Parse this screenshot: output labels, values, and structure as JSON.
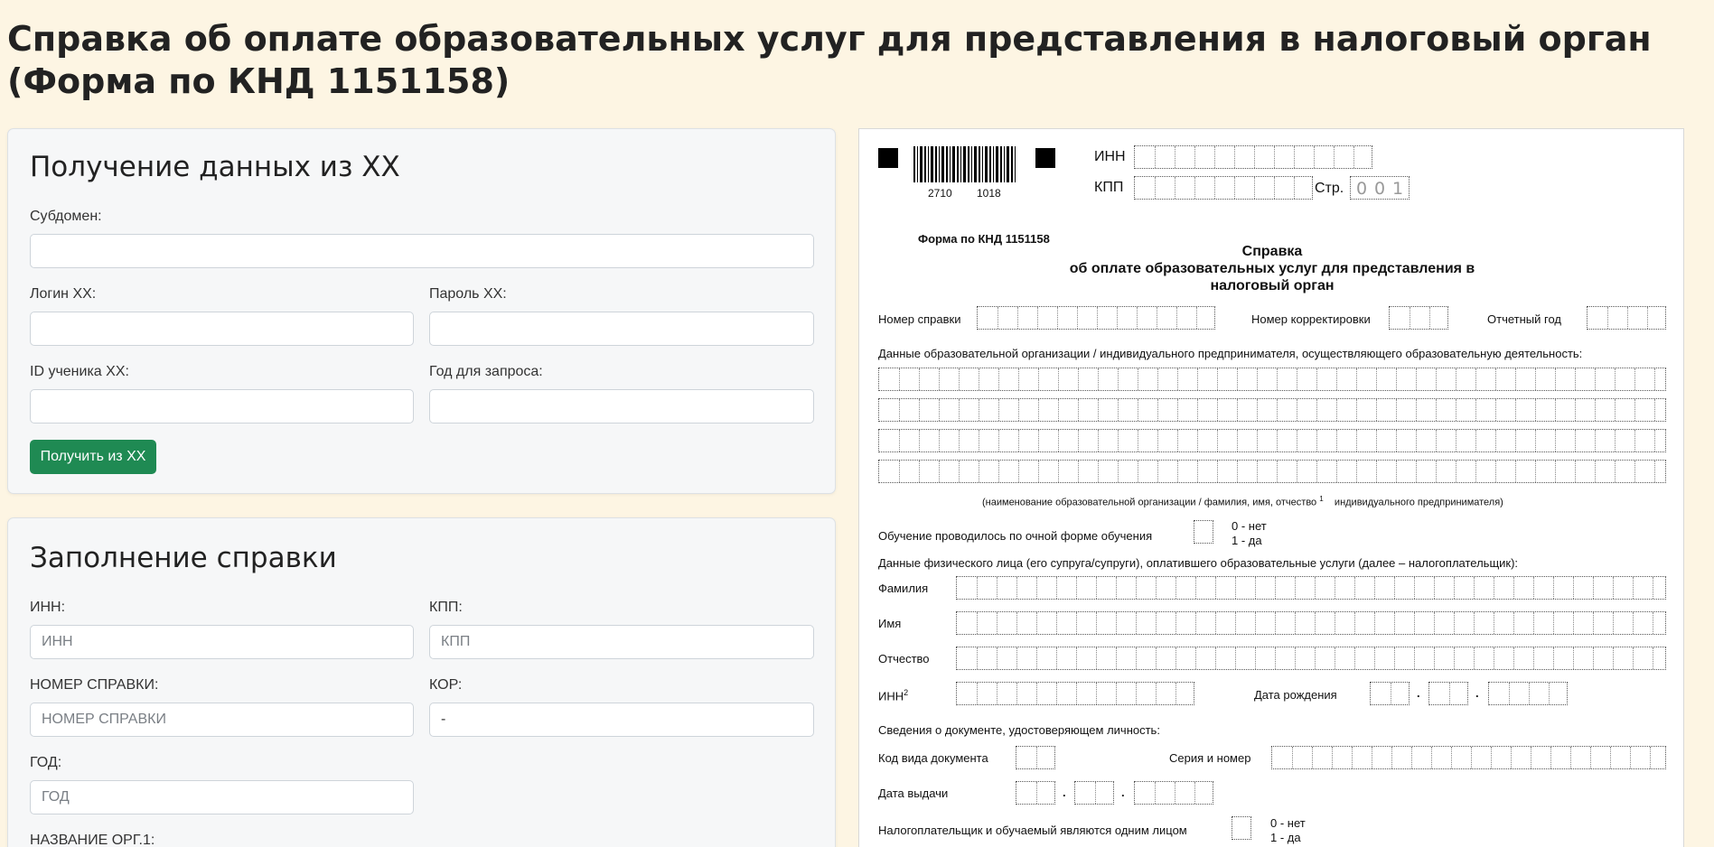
{
  "page": {
    "title": "Справка об оплате образовательных услуг для представления в налоговый орган (Форма по КНД 1151158)"
  },
  "fetch_card": {
    "title": "Получение данных из XX",
    "subdomain_label": "Субдомен:",
    "subdomain_value": "",
    "login_label": "Логин XX:",
    "login_value": "",
    "password_label": "Пароль XX:",
    "password_value": "",
    "student_id_label": "ID ученика XX:",
    "student_id_value": "",
    "year_label": "Год для запроса:",
    "year_value": "",
    "fetch_button": "Получить из XX"
  },
  "fill_card": {
    "title": "Заполнение справки",
    "inn_label": "ИНН:",
    "inn_placeholder": "ИНН",
    "kpp_label": "КПП:",
    "kpp_placeholder": "КПП",
    "number_label": "НОМЕР СПРАВКИ:",
    "number_placeholder": "НОМЕР СПРАВКИ",
    "kor_label": "КОР:",
    "kor_value": "-",
    "year_label": "ГОД:",
    "year_placeholder": "ГОД",
    "org_name_label": "НАЗВАНИЕ ОРГ.1:"
  },
  "form_preview": {
    "barcode_left": "2710",
    "barcode_right": "1018",
    "inn_label": "ИНН",
    "kpp_label": "КПП",
    "page_label": "Стр.",
    "page_number": [
      "0",
      "0",
      "1"
    ],
    "form_code": "Форма по КНД 1151158",
    "heading_line1": "Справка",
    "heading_line2": "об оплате образовательных услуг для представления в",
    "heading_line3": "налоговый орган",
    "cert_number_label": "Номер справки",
    "correction_label": "Номер корректировки",
    "report_year_label": "Отчетный год",
    "org_data_label": "Данные образовательной организации / индивидуального предпринимателя, осуществляющего образовательную деятельность:",
    "org_caption": "(наименование образовательной организации / фамилия, имя, отчество",
    "org_caption_sup": "1",
    "org_caption_tail": "индивидуального предпринимателя)",
    "fulltime_label": "Обучение проводилось по очной форме обучения",
    "opt_no": "0 - нет",
    "opt_yes": "1 - да",
    "payer_label": "Данные физического лица (его супруга/супруги), оплатившего образовательные услуги (далее – налогоплательщик):",
    "surname_label": "Фамилия",
    "name_label": "Имя",
    "patronymic_label": "Отчество",
    "payer_inn_label": "ИНН",
    "payer_inn_sup": "2",
    "birth_label": "Дата рождения",
    "id_doc_label": "Сведения о документе, удостоверяющем личность:",
    "doc_code_label": "Код вида документа",
    "series_label": "Серия и номер",
    "issue_date_label": "Дата выдачи",
    "same_person_label": "Налогоплательщик и обучаемый являются одним лицом",
    "same_no": "0 - нет",
    "same_yes": "1 - да"
  }
}
